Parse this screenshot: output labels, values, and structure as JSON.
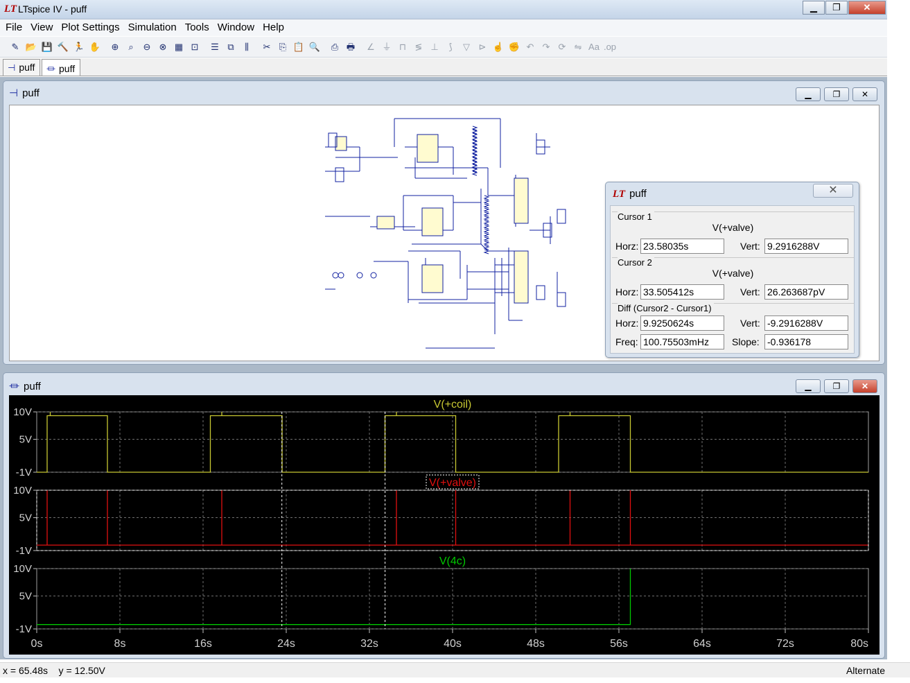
{
  "app": {
    "title": "LTspice IV - puff",
    "logo": "LT"
  },
  "menu": [
    "File",
    "View",
    "Plot Settings",
    "Simulation",
    "Tools",
    "Window",
    "Help"
  ],
  "toolbar_icons": [
    "new-schematic-icon",
    "open-icon",
    "save-icon",
    "control-panel-icon",
    "run-icon",
    "halt-icon",
    "zoom-in-icon",
    "zoom-box-icon",
    "zoom-out-icon",
    "zoom-cancel-icon",
    "autorange-icon",
    "fit-icon",
    "tile-horizontal-icon",
    "cascade-icon",
    "tile-vertical-icon",
    "cut-icon",
    "copy-icon",
    "paste-icon",
    "find-icon",
    "print-preview-icon",
    "print-icon",
    "wire-icon",
    "ground-icon",
    "label-icon",
    "resistor-icon",
    "capacitor-icon",
    "inductor-icon",
    "diode-icon",
    "component-icon",
    "move-icon",
    "drag-icon",
    "undo-icon",
    "redo-icon",
    "rotate-icon",
    "mirror-icon",
    "text-icon",
    "spice-directive-icon"
  ],
  "tabs": [
    {
      "label": "puff",
      "icon": "schematic-icon"
    },
    {
      "label": "puff",
      "icon": "waveform-icon"
    }
  ],
  "schematic_window": {
    "title": "puff"
  },
  "cursor_window": {
    "title": "puff",
    "cursor1": {
      "label": "Cursor 1",
      "expr": "V(+valve)",
      "horz_label": "Horz:",
      "horz": "23.58035s",
      "vert_label": "Vert:",
      "vert": "9.2916288V"
    },
    "cursor2": {
      "label": "Cursor 2",
      "expr": "V(+valve)",
      "horz_label": "Horz:",
      "horz": "33.505412s",
      "vert_label": "Vert:",
      "vert": "26.263687pV"
    },
    "diff": {
      "label": "Diff (Cursor2 - Cursor1)",
      "horz_label": "Horz:",
      "horz": "9.9250624s",
      "vert_label": "Vert:",
      "vert": "-9.2916288V",
      "freq_label": "Freq:",
      "freq": "100.75503mHz",
      "slope_label": "Slope:",
      "slope": "-0.936178"
    }
  },
  "plot_window": {
    "title": "puff"
  },
  "status": {
    "coords": "x = 65.48s    y = 12.50V",
    "mode": "Alternate"
  },
  "chart_data": {
    "type": "line",
    "x_ticks": [
      "0s",
      "8s",
      "16s",
      "24s",
      "32s",
      "40s",
      "48s",
      "56s",
      "64s",
      "72s",
      "80s"
    ],
    "xlim": [
      0,
      80
    ],
    "panes": [
      {
        "title": "V(+coil)",
        "color": "#c8c832",
        "ylim": [
          -1,
          10
        ],
        "y_ticks": [
          "10V",
          "5V",
          "-1V"
        ],
        "points": [
          [
            0,
            -1
          ],
          [
            1,
            -1
          ],
          [
            1,
            9.3
          ],
          [
            1.3,
            9.3
          ],
          [
            1.3,
            10
          ],
          [
            1.3,
            9.3
          ],
          [
            6.8,
            9.3
          ],
          [
            6.8,
            -1
          ],
          [
            16.7,
            -1
          ],
          [
            16.7,
            9.3
          ],
          [
            17.8,
            9.3
          ],
          [
            17.8,
            10
          ],
          [
            17.8,
            9.3
          ],
          [
            23.6,
            9.3
          ],
          [
            23.6,
            -1
          ],
          [
            33.5,
            -1
          ],
          [
            33.5,
            9.3
          ],
          [
            34.6,
            9.3
          ],
          [
            34.6,
            10
          ],
          [
            34.6,
            9.3
          ],
          [
            40.3,
            9.3
          ],
          [
            40.3,
            -1
          ],
          [
            50.2,
            -1
          ],
          [
            50.2,
            9.3
          ],
          [
            51.3,
            9.3
          ],
          [
            51.3,
            10
          ],
          [
            51.3,
            9.3
          ],
          [
            57.1,
            9.3
          ],
          [
            57.1,
            -1
          ],
          [
            80,
            -1
          ]
        ]
      },
      {
        "title": "V(+valve)",
        "color": "#e01010",
        "ylim": [
          -1,
          10
        ],
        "y_ticks": [
          "10V",
          "5V",
          "-1V"
        ],
        "points": [
          [
            0,
            0
          ],
          [
            1,
            0
          ],
          [
            1,
            10
          ],
          [
            1,
            0
          ],
          [
            6.8,
            0
          ],
          [
            6.8,
            10
          ],
          [
            6.8,
            0
          ],
          [
            17.8,
            0
          ],
          [
            17.8,
            10
          ],
          [
            17.8,
            0
          ],
          [
            34.6,
            0
          ],
          [
            34.6,
            10
          ],
          [
            34.6,
            0
          ],
          [
            40.3,
            0
          ],
          [
            40.3,
            10
          ],
          [
            40.3,
            0
          ],
          [
            51.3,
            0
          ],
          [
            51.3,
            10
          ],
          [
            51.3,
            0
          ],
          [
            57.1,
            0
          ],
          [
            57.1,
            10
          ],
          [
            57.1,
            0
          ],
          [
            80,
            0
          ]
        ]
      },
      {
        "title": "V(4c)",
        "color": "#00c800",
        "ylim": [
          -1,
          10
        ],
        "y_ticks": [
          "10V",
          "5V",
          "-1V"
        ],
        "points": [
          [
            0,
            -0.2
          ],
          [
            57.1,
            -0.2
          ],
          [
            57.1,
            10
          ],
          [
            57.1,
            10
          ]
        ]
      }
    ],
    "cursors_x": [
      23.58035,
      33.505412
    ]
  }
}
